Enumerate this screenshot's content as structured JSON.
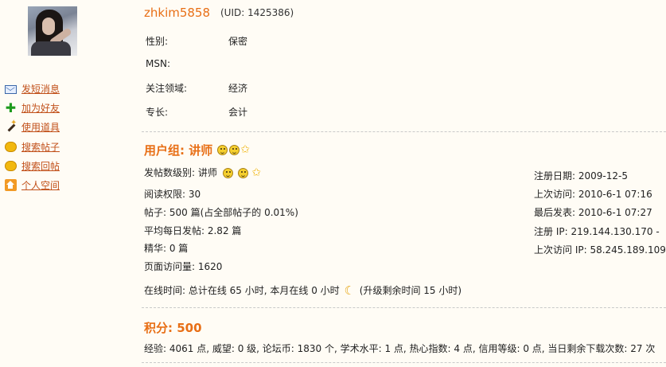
{
  "profile": {
    "username": "zhkim5858",
    "uid": "(UID: 1425386)"
  },
  "actions": [
    {
      "label": "发短消息",
      "icon": "mail-icon"
    },
    {
      "label": "加为好友",
      "icon": "add-friend-icon"
    },
    {
      "label": "使用道具",
      "icon": "magic-wand-icon"
    },
    {
      "label": "搜索帖子",
      "icon": "chat-bubble-icon"
    },
    {
      "label": "搜索回帖",
      "icon": "chat-bubble-icon"
    },
    {
      "label": "个人空间",
      "icon": "home-icon"
    }
  ],
  "info": [
    {
      "label": "性别:",
      "value": "保密"
    },
    {
      "label": "MSN:",
      "value": ""
    },
    {
      "label": "关注领域:",
      "value": "经济"
    },
    {
      "label": "专长:",
      "value": "会计"
    }
  ],
  "group": {
    "title": "用户组: 讲师"
  },
  "stats": {
    "level": "发帖数级别: 讲师",
    "read_perm": "阅读权限: 30",
    "posts": "帖子: 500 篇(占全部帖子的 0.01%)",
    "avg_posts": "平均每日发帖: 2.82 篇",
    "digest": "精华: 0 篇",
    "page_views": "页面访问量: 1620",
    "online_a": "在线时间: 总计在线 65 小时, 本月在线 0 小时",
    "online_b": "(升级剩余时间 15 小时)"
  },
  "dates": {
    "register_date": "注册日期: 2009-12-5",
    "last_visit": "上次访问: 2010-6-1 07:16",
    "last_post": "最后发表: 2010-6-1 07:27",
    "register_ip": "注册 IP: 219.144.130.170 -",
    "last_ip": "上次访问 IP: 58.245.189.109 -"
  },
  "points": {
    "title": "积分: 500",
    "detail": "经验: 4061 点, 威望: 0 级, 论坛币: 1830 个, 学术水平: 1 点, 热心指数: 4 点, 信用等级: 0 点, 当日剩余下载次数: 27 次"
  },
  "colors": {
    "accent": "#e86f16",
    "link": "#c1501a",
    "background": "#fffcf5"
  }
}
